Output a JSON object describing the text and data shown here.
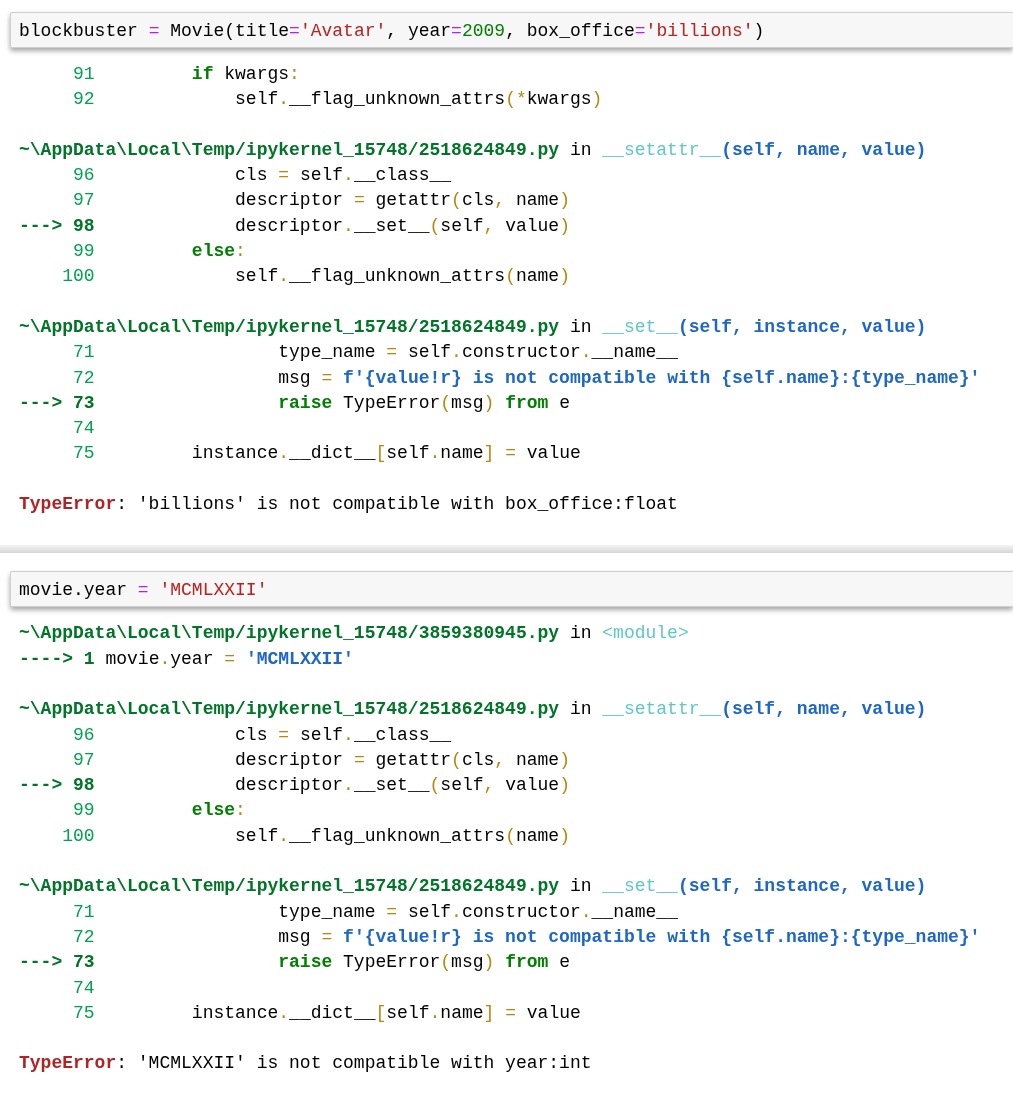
{
  "cells": [
    {
      "input": [
        {
          "t": "blockbuster ",
          "kind": "plain"
        },
        {
          "t": "=",
          "kind": "op"
        },
        {
          "t": " Movie(title",
          "kind": "plain"
        },
        {
          "t": "=",
          "kind": "op"
        },
        {
          "t": "'Avatar'",
          "kind": "str"
        },
        {
          "t": ", year",
          "kind": "plain"
        },
        {
          "t": "=",
          "kind": "op"
        },
        {
          "t": "2009",
          "kind": "num"
        },
        {
          "t": ", box_office",
          "kind": "plain"
        },
        {
          "t": "=",
          "kind": "op"
        },
        {
          "t": "'billions'",
          "kind": "str"
        },
        {
          "t": ")",
          "kind": "plain"
        }
      ],
      "output": [
        [
          [
            {
              "t": "     91",
              "kind": "lineno"
            },
            {
              "t": "         if",
              "kind": "kw"
            },
            {
              "t": " kwargs",
              "kind": "plain"
            },
            {
              "t": ":",
              "kind": "punct"
            }
          ],
          [
            {
              "t": "     92",
              "kind": "lineno"
            },
            {
              "t": "             self",
              "kind": "plain"
            },
            {
              "t": ".",
              "kind": "punct"
            },
            {
              "t": "__flag_unknown_attrs",
              "kind": "plain"
            },
            {
              "t": "(*",
              "kind": "punct"
            },
            {
              "t": "kwargs",
              "kind": "plain"
            },
            {
              "t": ")",
              "kind": "punct"
            }
          ]
        ],
        [
          [
            {
              "t": "~\\AppData\\Local\\Temp/ipykernel_15748/2518624849.py",
              "kind": "path"
            },
            {
              "t": " in ",
              "kind": "plain"
            },
            {
              "t": "__setattr__",
              "kind": "func"
            },
            {
              "t": "(self, name, value)",
              "kind": "args"
            }
          ],
          [
            {
              "t": "     96",
              "kind": "lineno"
            },
            {
              "t": "             cls ",
              "kind": "plain"
            },
            {
              "t": "=",
              "kind": "punct"
            },
            {
              "t": " self",
              "kind": "plain"
            },
            {
              "t": ".",
              "kind": "punct"
            },
            {
              "t": "__class__",
              "kind": "plain"
            }
          ],
          [
            {
              "t": "     97",
              "kind": "lineno"
            },
            {
              "t": "             descriptor ",
              "kind": "plain"
            },
            {
              "t": "=",
              "kind": "punct"
            },
            {
              "t": " getattr",
              "kind": "plain"
            },
            {
              "t": "(",
              "kind": "punct"
            },
            {
              "t": "cls",
              "kind": "plain"
            },
            {
              "t": ",",
              "kind": "punct"
            },
            {
              "t": " name",
              "kind": "plain"
            },
            {
              "t": ")",
              "kind": "punct"
            }
          ],
          [
            {
              "t": "---> 98",
              "kind": "arrow"
            },
            {
              "t": "             descriptor",
              "kind": "plain"
            },
            {
              "t": ".",
              "kind": "punct"
            },
            {
              "t": "__set__",
              "kind": "plain"
            },
            {
              "t": "(",
              "kind": "punct"
            },
            {
              "t": "self",
              "kind": "plain"
            },
            {
              "t": ",",
              "kind": "punct"
            },
            {
              "t": " value",
              "kind": "plain"
            },
            {
              "t": ")",
              "kind": "punct"
            }
          ],
          [
            {
              "t": "     99",
              "kind": "lineno"
            },
            {
              "t": "         else",
              "kind": "kw"
            },
            {
              "t": ":",
              "kind": "punct"
            }
          ],
          [
            {
              "t": "    100",
              "kind": "lineno"
            },
            {
              "t": "             self",
              "kind": "plain"
            },
            {
              "t": ".",
              "kind": "punct"
            },
            {
              "t": "__flag_unknown_attrs",
              "kind": "plain"
            },
            {
              "t": "(",
              "kind": "punct"
            },
            {
              "t": "name",
              "kind": "plain"
            },
            {
              "t": ")",
              "kind": "punct"
            }
          ]
        ],
        [
          [
            {
              "t": "~\\AppData\\Local\\Temp/ipykernel_15748/2518624849.py",
              "kind": "path"
            },
            {
              "t": " in ",
              "kind": "plain"
            },
            {
              "t": "__set__",
              "kind": "func"
            },
            {
              "t": "(self, instance, value)",
              "kind": "args"
            }
          ],
          [
            {
              "t": "     71",
              "kind": "lineno"
            },
            {
              "t": "                 type_name ",
              "kind": "plain"
            },
            {
              "t": "=",
              "kind": "punct"
            },
            {
              "t": " self",
              "kind": "plain"
            },
            {
              "t": ".",
              "kind": "punct"
            },
            {
              "t": "constructor",
              "kind": "plain"
            },
            {
              "t": ".",
              "kind": "punct"
            },
            {
              "t": "__name__",
              "kind": "plain"
            }
          ],
          [
            {
              "t": "     72",
              "kind": "lineno"
            },
            {
              "t": "                 msg ",
              "kind": "plain"
            },
            {
              "t": "=",
              "kind": "punct"
            },
            {
              "t": " f'{value!r} is not compatible with {self.name}:{type_name}'",
              "kind": "tstr"
            }
          ],
          [
            {
              "t": "---> 73",
              "kind": "arrow"
            },
            {
              "t": "                 raise",
              "kind": "kw"
            },
            {
              "t": " TypeError",
              "kind": "plain"
            },
            {
              "t": "(",
              "kind": "punct"
            },
            {
              "t": "msg",
              "kind": "plain"
            },
            {
              "t": ")",
              "kind": "punct"
            },
            {
              "t": " from",
              "kind": "kw"
            },
            {
              "t": " e",
              "kind": "plain"
            }
          ],
          [
            {
              "t": "     74",
              "kind": "lineno"
            }
          ],
          [
            {
              "t": "     75",
              "kind": "lineno"
            },
            {
              "t": "         instance",
              "kind": "plain"
            },
            {
              "t": ".",
              "kind": "punct"
            },
            {
              "t": "__dict__",
              "kind": "plain"
            },
            {
              "t": "[",
              "kind": "punct"
            },
            {
              "t": "self",
              "kind": "plain"
            },
            {
              "t": ".",
              "kind": "punct"
            },
            {
              "t": "name",
              "kind": "plain"
            },
            {
              "t": "] ",
              "kind": "punct"
            },
            {
              "t": "=",
              "kind": "punct"
            },
            {
              "t": " value",
              "kind": "plain"
            }
          ]
        ],
        [
          [
            {
              "t": "TypeError",
              "kind": "err"
            },
            {
              "t": ": 'billions' is not compatible with box_office:float",
              "kind": "plain"
            }
          ]
        ]
      ]
    },
    {
      "input": [
        {
          "t": "movie.year ",
          "kind": "plain"
        },
        {
          "t": "=",
          "kind": "op"
        },
        {
          "t": " 'MCMLXXII'",
          "kind": "str"
        }
      ],
      "output": [
        [
          [
            {
              "t": "~\\AppData\\Local\\Temp/ipykernel_15748/3859380945.py",
              "kind": "path"
            },
            {
              "t": " in ",
              "kind": "plain"
            },
            {
              "t": "<module>",
              "kind": "func"
            }
          ],
          [
            {
              "t": "----> 1",
              "kind": "arrow"
            },
            {
              "t": " movie",
              "kind": "plain"
            },
            {
              "t": ".",
              "kind": "punct"
            },
            {
              "t": "year ",
              "kind": "plain"
            },
            {
              "t": "=",
              "kind": "punct"
            },
            {
              "t": " 'MCMLXXII'",
              "kind": "tstr"
            }
          ]
        ],
        [
          [
            {
              "t": "~\\AppData\\Local\\Temp/ipykernel_15748/2518624849.py",
              "kind": "path"
            },
            {
              "t": " in ",
              "kind": "plain"
            },
            {
              "t": "__setattr__",
              "kind": "func"
            },
            {
              "t": "(self, name, value)",
              "kind": "args"
            }
          ],
          [
            {
              "t": "     96",
              "kind": "lineno"
            },
            {
              "t": "             cls ",
              "kind": "plain"
            },
            {
              "t": "=",
              "kind": "punct"
            },
            {
              "t": " self",
              "kind": "plain"
            },
            {
              "t": ".",
              "kind": "punct"
            },
            {
              "t": "__class__",
              "kind": "plain"
            }
          ],
          [
            {
              "t": "     97",
              "kind": "lineno"
            },
            {
              "t": "             descriptor ",
              "kind": "plain"
            },
            {
              "t": "=",
              "kind": "punct"
            },
            {
              "t": " getattr",
              "kind": "plain"
            },
            {
              "t": "(",
              "kind": "punct"
            },
            {
              "t": "cls",
              "kind": "plain"
            },
            {
              "t": ",",
              "kind": "punct"
            },
            {
              "t": " name",
              "kind": "plain"
            },
            {
              "t": ")",
              "kind": "punct"
            }
          ],
          [
            {
              "t": "---> 98",
              "kind": "arrow"
            },
            {
              "t": "             descriptor",
              "kind": "plain"
            },
            {
              "t": ".",
              "kind": "punct"
            },
            {
              "t": "__set__",
              "kind": "plain"
            },
            {
              "t": "(",
              "kind": "punct"
            },
            {
              "t": "self",
              "kind": "plain"
            },
            {
              "t": ",",
              "kind": "punct"
            },
            {
              "t": " value",
              "kind": "plain"
            },
            {
              "t": ")",
              "kind": "punct"
            }
          ],
          [
            {
              "t": "     99",
              "kind": "lineno"
            },
            {
              "t": "         else",
              "kind": "kw"
            },
            {
              "t": ":",
              "kind": "punct"
            }
          ],
          [
            {
              "t": "    100",
              "kind": "lineno"
            },
            {
              "t": "             self",
              "kind": "plain"
            },
            {
              "t": ".",
              "kind": "punct"
            },
            {
              "t": "__flag_unknown_attrs",
              "kind": "plain"
            },
            {
              "t": "(",
              "kind": "punct"
            },
            {
              "t": "name",
              "kind": "plain"
            },
            {
              "t": ")",
              "kind": "punct"
            }
          ]
        ],
        [
          [
            {
              "t": "~\\AppData\\Local\\Temp/ipykernel_15748/2518624849.py",
              "kind": "path"
            },
            {
              "t": " in ",
              "kind": "plain"
            },
            {
              "t": "__set__",
              "kind": "func"
            },
            {
              "t": "(self, instance, value)",
              "kind": "args"
            }
          ],
          [
            {
              "t": "     71",
              "kind": "lineno"
            },
            {
              "t": "                 type_name ",
              "kind": "plain"
            },
            {
              "t": "=",
              "kind": "punct"
            },
            {
              "t": " self",
              "kind": "plain"
            },
            {
              "t": ".",
              "kind": "punct"
            },
            {
              "t": "constructor",
              "kind": "plain"
            },
            {
              "t": ".",
              "kind": "punct"
            },
            {
              "t": "__name__",
              "kind": "plain"
            }
          ],
          [
            {
              "t": "     72",
              "kind": "lineno"
            },
            {
              "t": "                 msg ",
              "kind": "plain"
            },
            {
              "t": "=",
              "kind": "punct"
            },
            {
              "t": " f'{value!r} is not compatible with {self.name}:{type_name}'",
              "kind": "tstr"
            }
          ],
          [
            {
              "t": "---> 73",
              "kind": "arrow"
            },
            {
              "t": "                 raise",
              "kind": "kw"
            },
            {
              "t": " TypeError",
              "kind": "plain"
            },
            {
              "t": "(",
              "kind": "punct"
            },
            {
              "t": "msg",
              "kind": "plain"
            },
            {
              "t": ")",
              "kind": "punct"
            },
            {
              "t": " from",
              "kind": "kw"
            },
            {
              "t": " e",
              "kind": "plain"
            }
          ],
          [
            {
              "t": "     74",
              "kind": "lineno"
            }
          ],
          [
            {
              "t": "     75",
              "kind": "lineno"
            },
            {
              "t": "         instance",
              "kind": "plain"
            },
            {
              "t": ".",
              "kind": "punct"
            },
            {
              "t": "__dict__",
              "kind": "plain"
            },
            {
              "t": "[",
              "kind": "punct"
            },
            {
              "t": "self",
              "kind": "plain"
            },
            {
              "t": ".",
              "kind": "punct"
            },
            {
              "t": "name",
              "kind": "plain"
            },
            {
              "t": "] ",
              "kind": "punct"
            },
            {
              "t": "=",
              "kind": "punct"
            },
            {
              "t": " value",
              "kind": "plain"
            }
          ]
        ],
        [
          [
            {
              "t": "TypeError",
              "kind": "err"
            },
            {
              "t": ": 'MCMLXXII' is not compatible with year:int",
              "kind": "plain"
            }
          ]
        ]
      ]
    }
  ]
}
